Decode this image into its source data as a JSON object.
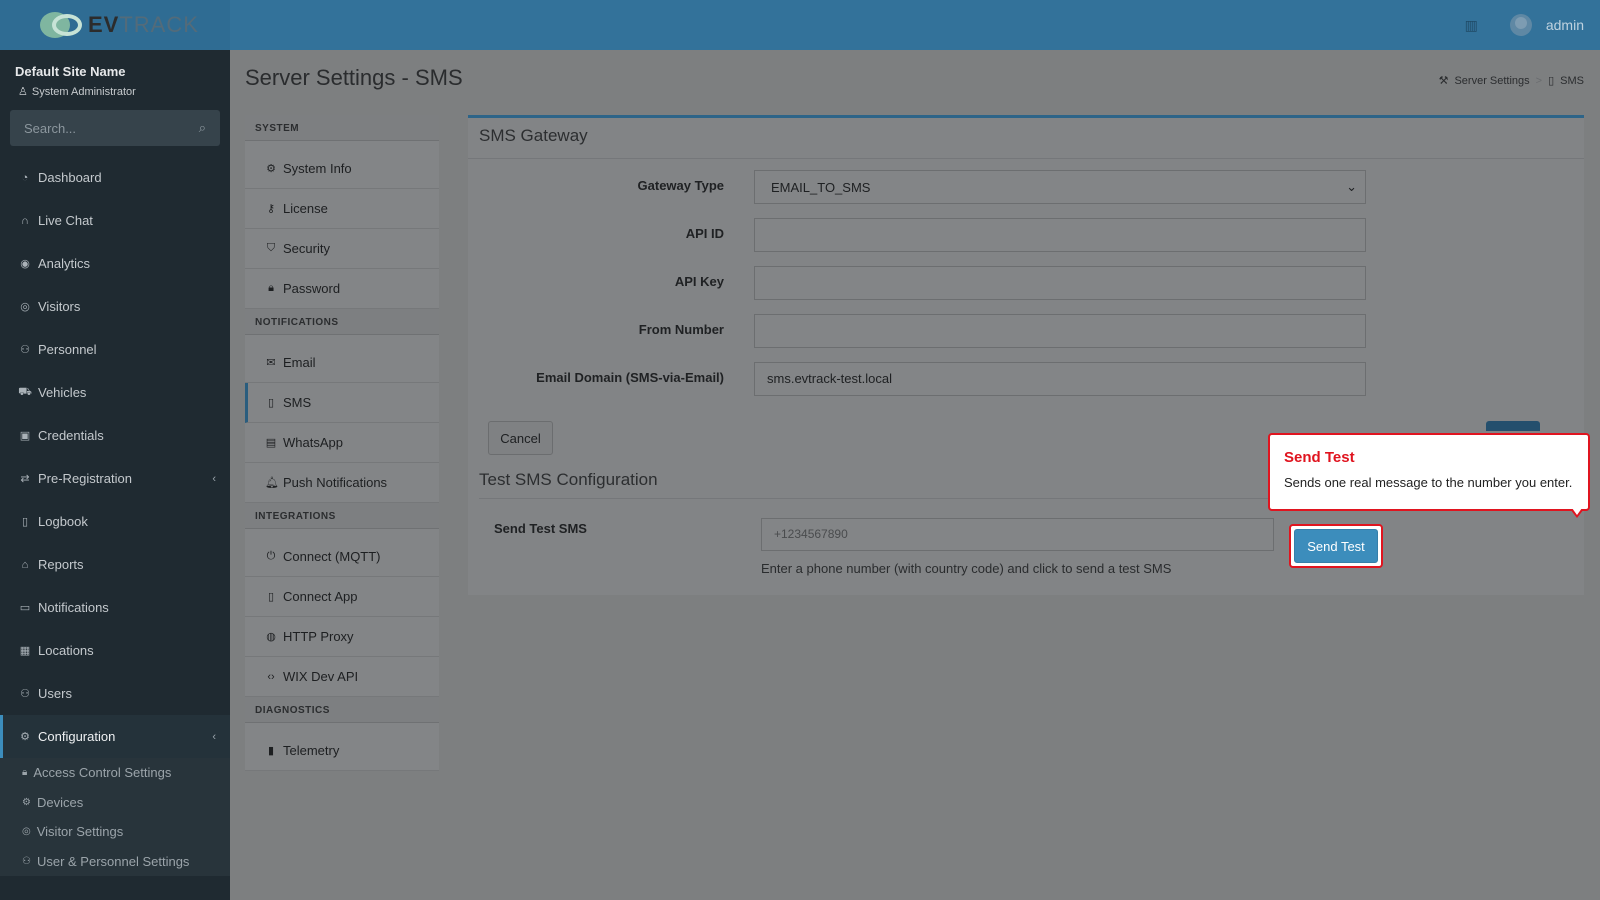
{
  "header": {
    "logo_text_ev": "EV",
    "logo_text_track": "TRACK",
    "username": "admin"
  },
  "sidebar": {
    "site_name": "Default Site Name",
    "role": "System Administrator",
    "search_placeholder": "Search...",
    "items": [
      {
        "label": "Dashboard",
        "icon": "dashboard-icon"
      },
      {
        "label": "Live Chat",
        "icon": "headset-icon"
      },
      {
        "label": "Analytics",
        "icon": "target-icon"
      },
      {
        "label": "Visitors",
        "icon": "eye-icon"
      },
      {
        "label": "Personnel",
        "icon": "people-icon"
      },
      {
        "label": "Vehicles",
        "icon": "car-icon"
      },
      {
        "label": "Credentials",
        "icon": "id-card-icon"
      },
      {
        "label": "Pre-Registration",
        "icon": "arrows-icon"
      },
      {
        "label": "Logbook",
        "icon": "book-icon"
      },
      {
        "label": "Reports",
        "icon": "chart-icon"
      },
      {
        "label": "Notifications",
        "icon": "chat-icon"
      },
      {
        "label": "Locations",
        "icon": "building-icon"
      },
      {
        "label": "Users",
        "icon": "users-icon"
      },
      {
        "label": "Configuration",
        "icon": "gear-icon"
      }
    ],
    "subitems": [
      {
        "label": "Access Control Settings"
      },
      {
        "label": "Devices"
      },
      {
        "label": "Visitor Settings"
      },
      {
        "label": "User & Personnel Settings"
      }
    ]
  },
  "page": {
    "title": "Server Settings - SMS",
    "breadcrumb": [
      "Server Settings",
      "SMS"
    ]
  },
  "settings_menu": {
    "sections": [
      {
        "title": "SYSTEM",
        "items": [
          "System Info",
          "License",
          "Security",
          "Password"
        ]
      },
      {
        "title": "NOTIFICATIONS",
        "items": [
          "Email",
          "SMS",
          "WhatsApp",
          "Push Notifications"
        ]
      },
      {
        "title": "INTEGRATIONS",
        "items": [
          "Connect (MQTT)",
          "Connect App",
          "HTTP Proxy",
          "WIX Dev API"
        ]
      },
      {
        "title": "DIAGNOSTICS",
        "items": [
          "Telemetry"
        ]
      }
    ],
    "active": "SMS"
  },
  "sms_gateway": {
    "title": "SMS Gateway",
    "fields": {
      "gateway_type_label": "Gateway Type",
      "gateway_type_value": "EMAIL_TO_SMS",
      "api_id_label": "API ID",
      "api_id_value": "",
      "api_key_label": "API Key",
      "api_key_value": "",
      "from_number_label": "From Number",
      "from_number_value": "",
      "email_domain_label": "Email Domain (SMS-via-Email)",
      "email_domain_value": "sms.evtrack-test.local"
    },
    "cancel_label": "Cancel"
  },
  "test_sms": {
    "title": "Test SMS Configuration",
    "label": "Send Test SMS",
    "placeholder": "+1234567890",
    "help": "Enter a phone number (with country code) and click to send a test SMS",
    "button_label": "Send Test"
  },
  "tooltip": {
    "title": "Send Test",
    "body": "Sends one real message to the number you enter."
  }
}
